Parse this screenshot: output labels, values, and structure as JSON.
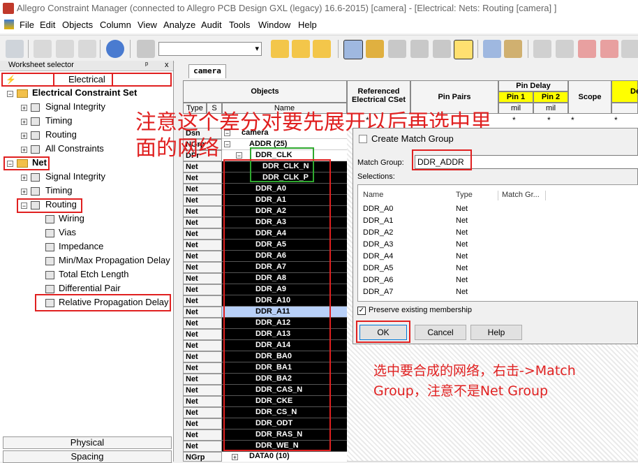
{
  "window": {
    "title": "Allegro Constraint Manager (connected to Allegro PCB Design GXL (legacy) 16.6-2015) [camera] - [Electrical:  Nets:  Routing [camera] ]"
  },
  "menu": [
    "File",
    "Edit",
    "Objects",
    "Column",
    "View",
    "Analyze",
    "Audit",
    "Tools",
    "Window",
    "Help"
  ],
  "toolbar": {
    "combo_value": "",
    "icons": [
      "print-icon",
      "cut-icon",
      "copy-icon",
      "paste-icon",
      "help-icon",
      "filter-icon",
      "select-icon",
      "constraint-icon",
      "dropdown-icon"
    ]
  },
  "worksheet_selector": {
    "header": "Worksheet selector",
    "pin": "ᵖ",
    "close": "x",
    "electrical_tab": "Electrical",
    "tree": {
      "ecset": "Electrical Constraint Set",
      "ecset_children": [
        "Signal Integrity",
        "Timing",
        "Routing",
        "All Constraints"
      ],
      "net": "Net",
      "net_children": [
        "Signal Integrity",
        "Timing",
        "Routing"
      ],
      "routing_children": [
        "Wiring",
        "Vias",
        "Impedance",
        "Min/Max Propagation Delay",
        "Total Etch Length",
        "Differential Pair",
        "Relative Propagation Delay"
      ]
    },
    "bottom_tabs": [
      "Physical",
      "Spacing"
    ]
  },
  "sheet": {
    "tab": "camera",
    "headers": {
      "objects": "Objects",
      "type": "Type",
      "s": "S",
      "name": "Name",
      "ref_ecset": "Referenced Electrical CSet",
      "pin_pairs": "Pin Pairs",
      "pin_delay": "Pin Delay",
      "pin1": "Pin 1",
      "pin2": "Pin 2",
      "unit1": "mil",
      "unit2": "mil",
      "scope": "Scope",
      "de": "De",
      "star": "*"
    },
    "rows": [
      {
        "type": "Dsn",
        "name": "camera",
        "expander": "⊟"
      },
      {
        "type": "NGrp",
        "name": "ADDR (25)",
        "expander": "⊟"
      },
      {
        "type": "DPr",
        "name": "DDR_CLK",
        "expander": "⊟"
      },
      {
        "type": "Net",
        "name": "DDR_CLK_N"
      },
      {
        "type": "Net",
        "name": "DDR_CLK_P"
      },
      {
        "type": "Net",
        "name": "DDR_A0"
      },
      {
        "type": "Net",
        "name": "DDR_A1"
      },
      {
        "type": "Net",
        "name": "DDR_A2"
      },
      {
        "type": "Net",
        "name": "DDR_A3"
      },
      {
        "type": "Net",
        "name": "DDR_A4"
      },
      {
        "type": "Net",
        "name": "DDR_A5"
      },
      {
        "type": "Net",
        "name": "DDR_A6"
      },
      {
        "type": "Net",
        "name": "DDR_A7"
      },
      {
        "type": "Net",
        "name": "DDR_A8"
      },
      {
        "type": "Net",
        "name": "DDR_A9"
      },
      {
        "type": "Net",
        "name": "DDR_A10"
      },
      {
        "type": "Net",
        "name": "DDR_A11"
      },
      {
        "type": "Net",
        "name": "DDR_A12"
      },
      {
        "type": "Net",
        "name": "DDR_A13"
      },
      {
        "type": "Net",
        "name": "DDR_A14"
      },
      {
        "type": "Net",
        "name": "DDR_BA0"
      },
      {
        "type": "Net",
        "name": "DDR_BA1"
      },
      {
        "type": "Net",
        "name": "DDR_BA2"
      },
      {
        "type": "Net",
        "name": "DDR_CAS_N"
      },
      {
        "type": "Net",
        "name": "DDR_CKE"
      },
      {
        "type": "Net",
        "name": "DDR_CS_N"
      },
      {
        "type": "Net",
        "name": "DDR_ODT"
      },
      {
        "type": "Net",
        "name": "DDR_RAS_N"
      },
      {
        "type": "Net",
        "name": "DDR_WE_N"
      },
      {
        "type": "NGrp",
        "name": "DATA0 (10)",
        "expander": "⊞"
      }
    ]
  },
  "annotations": {
    "top_line1": "注意这个差分对要先展开以后再选中里",
    "top_line2": "面的网络",
    "bottom_line1": "选中要合成的网络，右击->Match",
    "bottom_line2": "Group，注意不是Net Group"
  },
  "dialog": {
    "title": "Create Match Group",
    "match_group_label": "Match Group:",
    "match_group_value": "DDR_ADDR",
    "selections_label": "Selections:",
    "columns": [
      "Name",
      "Type",
      "Match Gr..."
    ],
    "rows": [
      {
        "name": "DDR_A0",
        "type": "Net"
      },
      {
        "name": "DDR_A1",
        "type": "Net"
      },
      {
        "name": "DDR_A2",
        "type": "Net"
      },
      {
        "name": "DDR_A3",
        "type": "Net"
      },
      {
        "name": "DDR_A4",
        "type": "Net"
      },
      {
        "name": "DDR_A5",
        "type": "Net"
      },
      {
        "name": "DDR_A6",
        "type": "Net"
      },
      {
        "name": "DDR_A7",
        "type": "Net"
      }
    ],
    "preserve_label": "Preserve existing membership",
    "preserve_checked": true,
    "ok": "OK",
    "cancel": "Cancel",
    "help": "Help"
  }
}
